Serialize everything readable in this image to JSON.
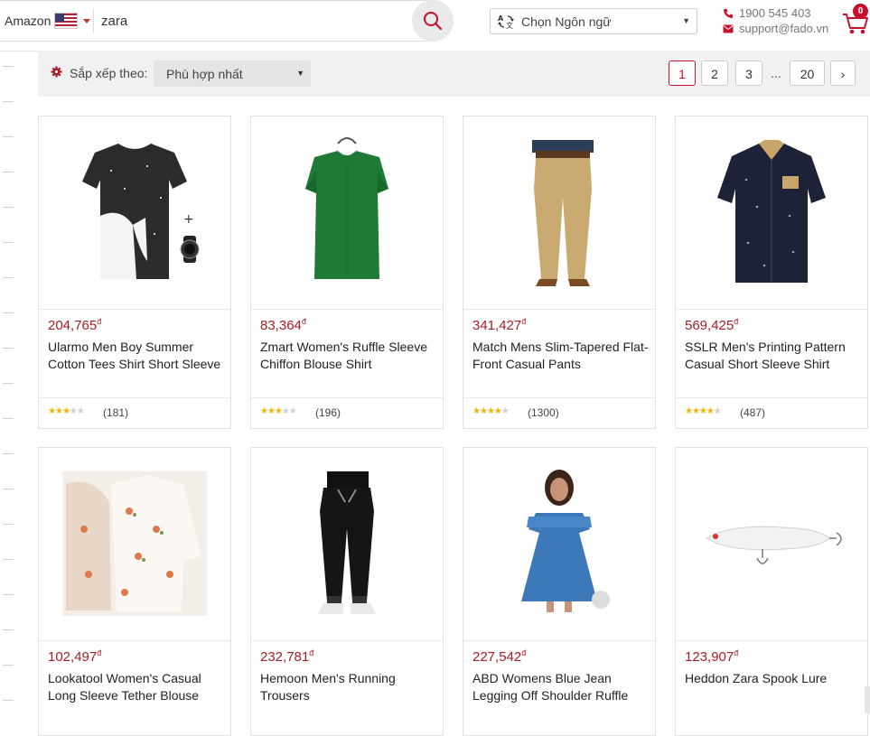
{
  "header": {
    "store_label": "Amazon",
    "search_value": "zara",
    "language_label": "Chọn Ngôn ngữ",
    "phone": "1900 545 403",
    "email": "support@fado.vn",
    "cart_count": "0"
  },
  "sort": {
    "label": "Sắp xếp theo:",
    "selected": "Phù hợp nhất"
  },
  "pagination": {
    "pages": [
      "1",
      "2",
      "3"
    ],
    "ellipsis": "...",
    "last_page": "20",
    "next_label": "›",
    "current": "1"
  },
  "currency_symbol": "đ",
  "products": [
    {
      "price": "204,765",
      "title": "Ularmo Men Boy Summer Cotton Tees Shirt Short Sleeve",
      "rating": 2.5,
      "reviews": "(181)",
      "image": "tshirt-with-watch"
    },
    {
      "price": "83,364",
      "title": "Zmart Women's Ruffle Sleeve Chiffon Blouse Shirt",
      "rating": 2.5,
      "reviews": "(196)",
      "image": "green-blouse"
    },
    {
      "price": "341,427",
      "title": "Match Mens Slim-Tapered Flat-Front Casual Pants",
      "rating": 4,
      "reviews": "(1300)",
      "image": "khaki-pants"
    },
    {
      "price": "569,425",
      "title": "SSLR Men's Printing Pattern Casual Short Sleeve Shirt",
      "rating": 4,
      "reviews": "(487)",
      "image": "navy-shirt"
    },
    {
      "price": "102,497",
      "title": "Lookatool Women's Casual Long Sleeve Tether Blouse",
      "image": "floral-blouse"
    },
    {
      "price": "232,781",
      "title": "Hemoon Men's Running Trousers",
      "image": "black-joggers"
    },
    {
      "price": "227,542",
      "title": "ABD Womens Blue Jean Legging Off Shoulder Ruffle",
      "image": "denim-dress"
    },
    {
      "price": "123,907",
      "title": "Heddon Zara Spook Lure",
      "image": "fishing-lure"
    }
  ],
  "colors": {
    "accent": "#a51d24",
    "active_page": "#c8102e",
    "star": "#f5b301"
  }
}
